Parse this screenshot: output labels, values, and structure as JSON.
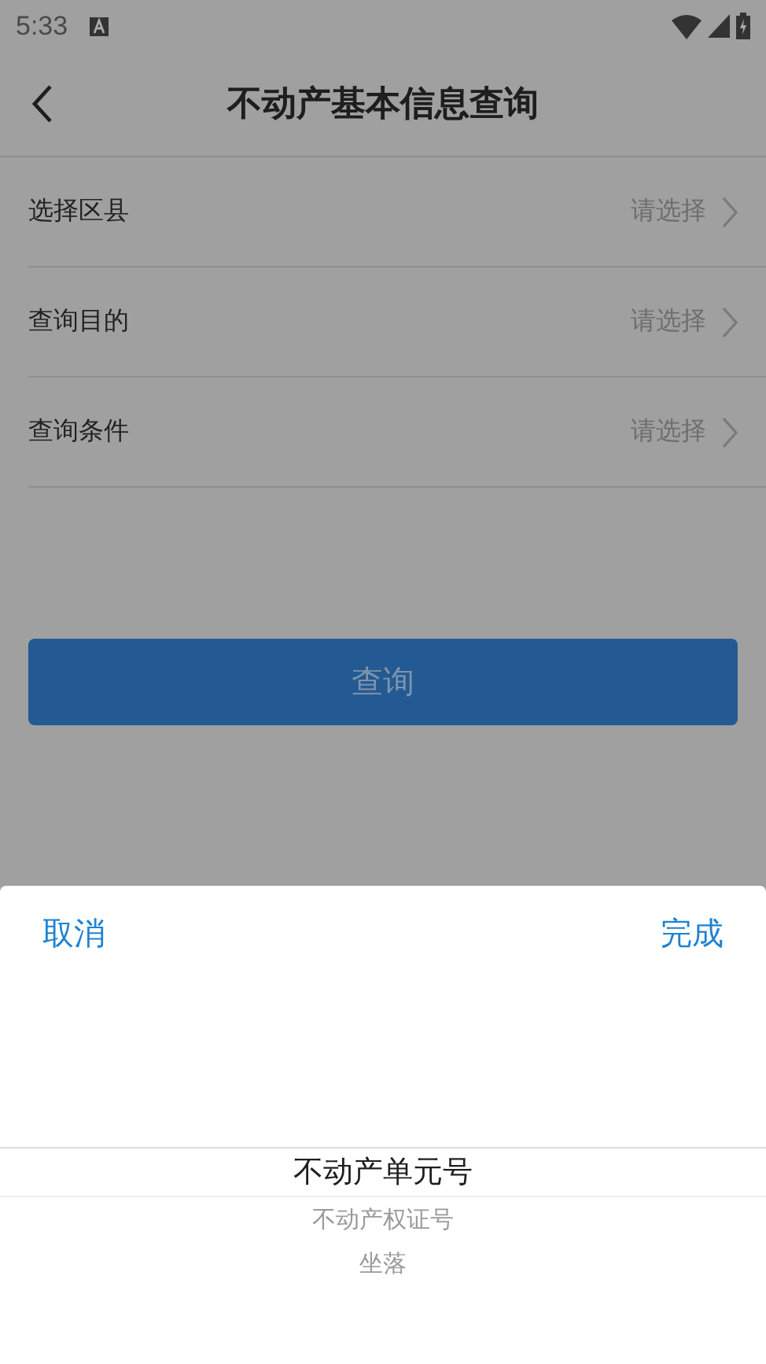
{
  "status_bar": {
    "time": "5:33"
  },
  "nav": {
    "title": "不动产基本信息查询"
  },
  "rows": [
    {
      "label": "选择区县",
      "value": "请选择"
    },
    {
      "label": "查询目的",
      "value": "请选择"
    },
    {
      "label": "查询条件",
      "value": "请选择"
    }
  ],
  "query_button": {
    "label": "查询",
    "disabled": true
  },
  "picker": {
    "cancel": "取消",
    "done": "完成",
    "options": [
      {
        "label": "不动产单元号",
        "selected": true
      },
      {
        "label": "不动产权证号",
        "selected": false
      },
      {
        "label": "坐落",
        "selected": false
      }
    ]
  }
}
